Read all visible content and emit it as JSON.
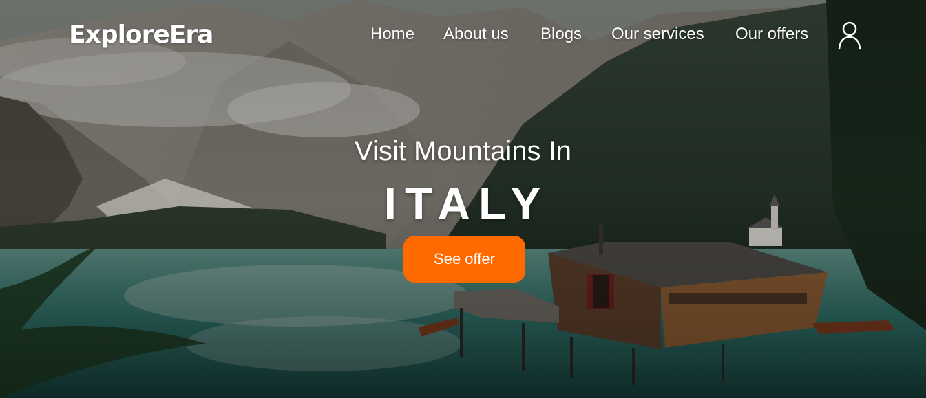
{
  "brand": {
    "name": "ExploreEra"
  },
  "nav": {
    "items": [
      {
        "label": "Home"
      },
      {
        "label": "About us"
      },
      {
        "label": "Blogs"
      },
      {
        "label": "Our services"
      },
      {
        "label": "Our offers"
      }
    ],
    "user_icon": "user-icon"
  },
  "hero": {
    "headline": "Visit Mountains In",
    "country": "ITALY",
    "cta_label": "See offer"
  },
  "colors": {
    "accent": "#ff6a00",
    "text": "#ffffff"
  }
}
